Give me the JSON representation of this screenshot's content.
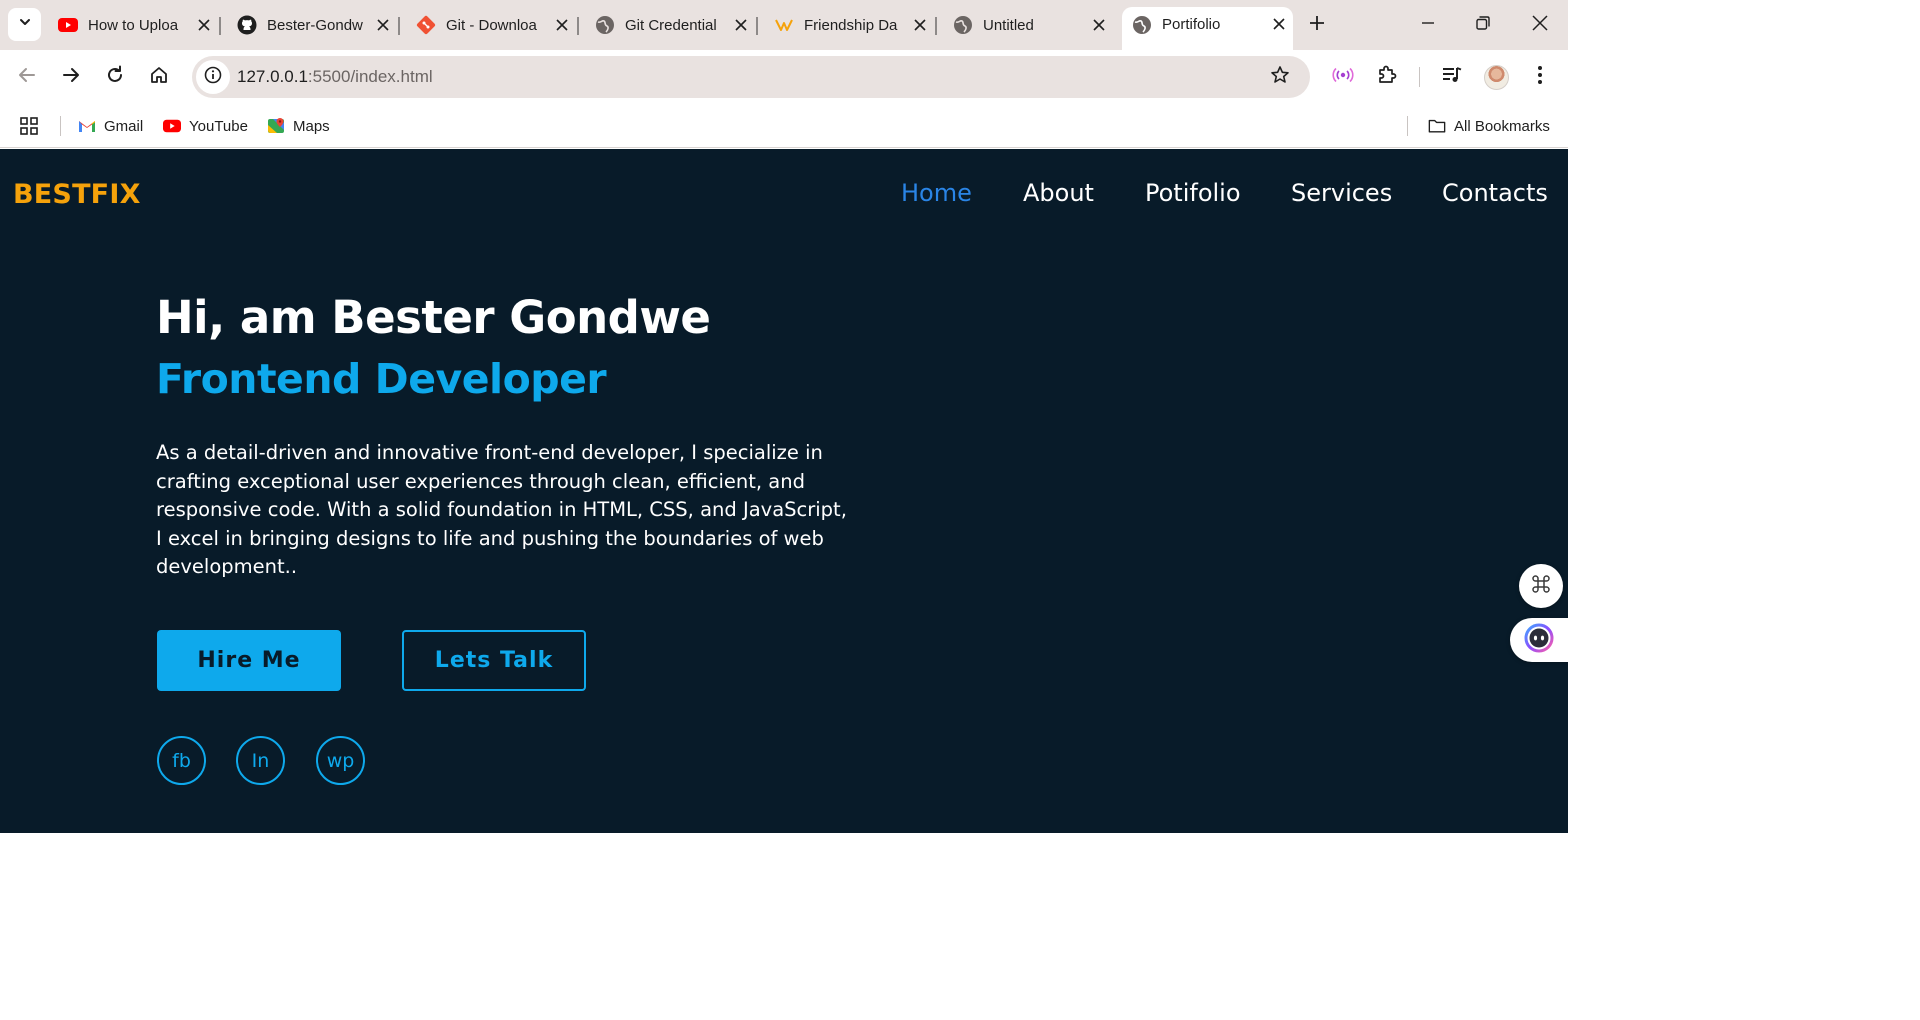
{
  "tabs": [
    {
      "title": "How to Uploa",
      "icon": "youtube-icon"
    },
    {
      "title": "Bester-Gondw",
      "icon": "github-icon"
    },
    {
      "title": "Git - Downloa",
      "icon": "git-icon"
    },
    {
      "title": "Git Credential",
      "icon": "globe-icon"
    },
    {
      "title": "Friendship Da",
      "icon": "friendship-icon"
    },
    {
      "title": "Untitled",
      "icon": "globe-icon"
    },
    {
      "title": "Portifolio",
      "icon": "globe-icon",
      "active": true
    }
  ],
  "address_bar": {
    "host": "127.0.0.1",
    "path": ":5500/index.html"
  },
  "bookmarks": {
    "items": [
      "Gmail",
      "YouTube",
      "Maps"
    ],
    "all_bookmarks": "All Bookmarks"
  },
  "site": {
    "logo": "BESTFIX",
    "nav": [
      "Home",
      "About",
      "Potifolio",
      "Services",
      "Contacts"
    ],
    "active_nav": "Home",
    "hero": {
      "greeting": "Hi, am Bester Gondwe",
      "role": "Frontend Developer",
      "bio": "As a detail-driven and innovative front-end developer, I specialize in crafting exceptional user experiences through clean, efficient, and responsive code. With a solid foundation in HTML, CSS, and JavaScript, I excel in bringing designs to life and pushing the boundaries of web development..",
      "hire_button": "Hire Me",
      "talk_button": "Lets Talk"
    },
    "social": [
      "fb",
      "In",
      "wp"
    ]
  },
  "colors": {
    "page_background": "#081b29",
    "accent": "#0ea9ec",
    "logo": "#f5a20b",
    "active_nav": "#2a85e6"
  }
}
